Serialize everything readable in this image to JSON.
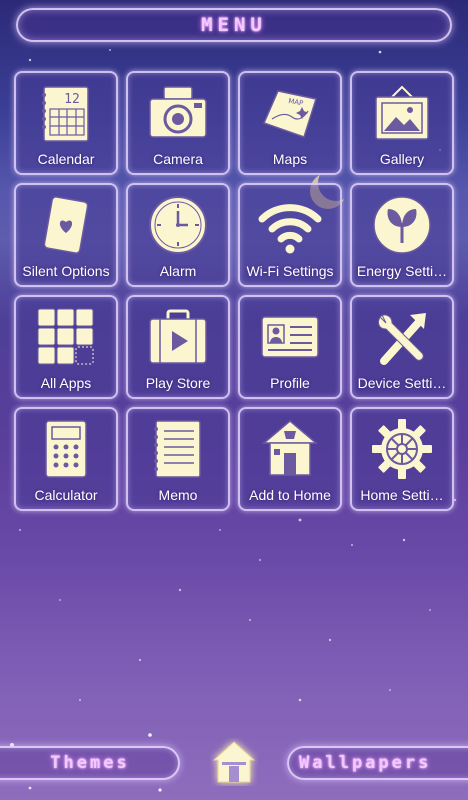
{
  "header": {
    "title": "MENU"
  },
  "apps": [
    {
      "label": "Calendar",
      "icon": "calendar-icon",
      "calendar_day": "12"
    },
    {
      "label": "Camera",
      "icon": "camera-icon"
    },
    {
      "label": "Maps",
      "icon": "map-icon",
      "map_text": "MAP"
    },
    {
      "label": "Gallery",
      "icon": "picture-frame-icon"
    },
    {
      "label": "Silent Options",
      "icon": "card-heart-icon"
    },
    {
      "label": "Alarm",
      "icon": "clock-icon"
    },
    {
      "label": "Wi-Fi Settings",
      "icon": "wifi-icon"
    },
    {
      "label": "Energy Setti…",
      "icon": "leaf-icon"
    },
    {
      "label": "All Apps",
      "icon": "app-grid-icon"
    },
    {
      "label": "Play Store",
      "icon": "suitcase-play-icon"
    },
    {
      "label": "Profile",
      "icon": "profile-card-icon"
    },
    {
      "label": "Device Setti…",
      "icon": "tools-icon"
    },
    {
      "label": "Calculator",
      "icon": "calculator-icon"
    },
    {
      "label": "Memo",
      "icon": "notebook-icon"
    },
    {
      "label": "Add to Home",
      "icon": "house-icon"
    },
    {
      "label": "Home Setti…",
      "icon": "gear-icon"
    }
  ],
  "dock": {
    "themes_label": "Themes",
    "wallpapers_label": "Wallpapers",
    "home_icon": "home-icon",
    "moon_icon": "crescent-moon-icon"
  },
  "colors": {
    "icon_fill": "#fbf6cf",
    "icon_stroke": "#6b5aa0",
    "title_glow": "#e07bff",
    "title_text": "#f3c8ff"
  }
}
